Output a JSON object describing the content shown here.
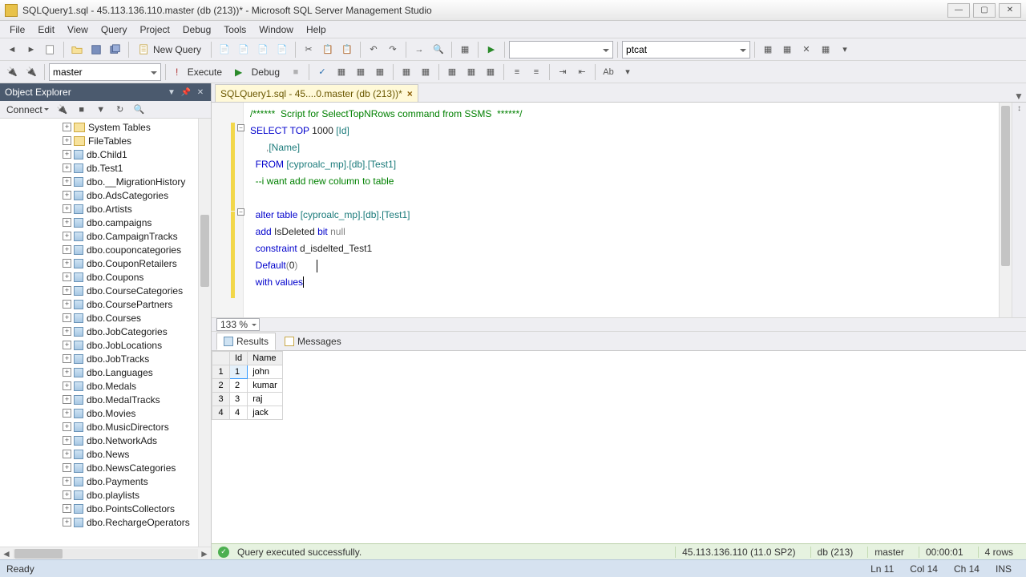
{
  "title": "SQLQuery1.sql - 45.113.136.110.master (db (213))* - Microsoft SQL Server Management Studio",
  "menu": [
    "File",
    "Edit",
    "View",
    "Query",
    "Project",
    "Debug",
    "Tools",
    "Window",
    "Help"
  ],
  "toolbar1": {
    "new_query": "New Query",
    "combo_db": "ptcat"
  },
  "toolbar2": {
    "db_combo": "master",
    "execute": "Execute",
    "debug": "Debug"
  },
  "object_explorer": {
    "title": "Object Explorer",
    "connect": "Connect",
    "items": [
      {
        "type": "folder",
        "label": "System Tables"
      },
      {
        "type": "folder",
        "label": "FileTables"
      },
      {
        "type": "table",
        "label": "db.Child1"
      },
      {
        "type": "table",
        "label": "db.Test1"
      },
      {
        "type": "table",
        "label": "dbo.__MigrationHistory"
      },
      {
        "type": "table",
        "label": "dbo.AdsCategories"
      },
      {
        "type": "table",
        "label": "dbo.Artists"
      },
      {
        "type": "table",
        "label": "dbo.campaigns"
      },
      {
        "type": "table",
        "label": "dbo.CampaignTracks"
      },
      {
        "type": "table",
        "label": "dbo.couponcategories"
      },
      {
        "type": "table",
        "label": "dbo.CouponRetailers"
      },
      {
        "type": "table",
        "label": "dbo.Coupons"
      },
      {
        "type": "table",
        "label": "dbo.CourseCategories"
      },
      {
        "type": "table",
        "label": "dbo.CoursePartners"
      },
      {
        "type": "table",
        "label": "dbo.Courses"
      },
      {
        "type": "table",
        "label": "dbo.JobCategories"
      },
      {
        "type": "table",
        "label": "dbo.JobLocations"
      },
      {
        "type": "table",
        "label": "dbo.JobTracks"
      },
      {
        "type": "table",
        "label": "dbo.Languages"
      },
      {
        "type": "table",
        "label": "dbo.Medals"
      },
      {
        "type": "table",
        "label": "dbo.MedalTracks"
      },
      {
        "type": "table",
        "label": "dbo.Movies"
      },
      {
        "type": "table",
        "label": "dbo.MusicDirectors"
      },
      {
        "type": "table",
        "label": "dbo.NetworkAds"
      },
      {
        "type": "table",
        "label": "dbo.News"
      },
      {
        "type": "table",
        "label": "dbo.NewsCategories"
      },
      {
        "type": "table",
        "label": "dbo.Payments"
      },
      {
        "type": "table",
        "label": "dbo.playlists"
      },
      {
        "type": "table",
        "label": "dbo.PointsCollectors"
      },
      {
        "type": "table",
        "label": "dbo.RechargeOperators"
      }
    ]
  },
  "doc_tab": "SQLQuery1.sql - 45....0.master (db (213))*",
  "code": {
    "l1a": "/******  Script for SelectTopNRows command from SSMS  ******/",
    "l2_kw1": "SELECT",
    "l2_kw2": "TOP",
    "l2_num": "1000",
    "l2_id": "[Id]",
    "l3_pre": "      ,",
    "l3_id": "[Name]",
    "l4_kw": "FROM",
    "l4_id": "[cyproalc_mp].[db].[Test1]",
    "l5": "--i want add new column to table",
    "l7_kw": "alter table",
    "l7_id": "[cyproalc_mp].[db].[Test1]",
    "l8a": "add",
    "l8b": "IsDeleted",
    "l8c": "bit",
    "l8d": "null",
    "l9a": "constraint",
    "l9b": "d_isdelted_Test1",
    "l10a": "Default",
    "l10b": "(",
    "l10c": "0",
    "l10d": ")",
    "l11a": "with",
    "l11b": "values"
  },
  "zoom": "133 %",
  "results": {
    "tab_results": "Results",
    "tab_messages": "Messages",
    "columns": [
      "",
      "Id",
      "Name"
    ],
    "rows": [
      {
        "n": "1",
        "id": "1",
        "name": "john"
      },
      {
        "n": "2",
        "id": "2",
        "name": "kumar"
      },
      {
        "n": "3",
        "id": "3",
        "name": "raj"
      },
      {
        "n": "4",
        "id": "4",
        "name": "jack"
      }
    ]
  },
  "qstatus": {
    "msg": "Query executed successfully.",
    "server": "45.113.136.110 (11.0 SP2)",
    "db": "db (213)",
    "dbname": "master",
    "time": "00:00:01",
    "rows": "4 rows"
  },
  "status": {
    "ready": "Ready",
    "ln": "Ln 11",
    "col": "Col 14",
    "ch": "Ch 14",
    "ins": "INS"
  }
}
